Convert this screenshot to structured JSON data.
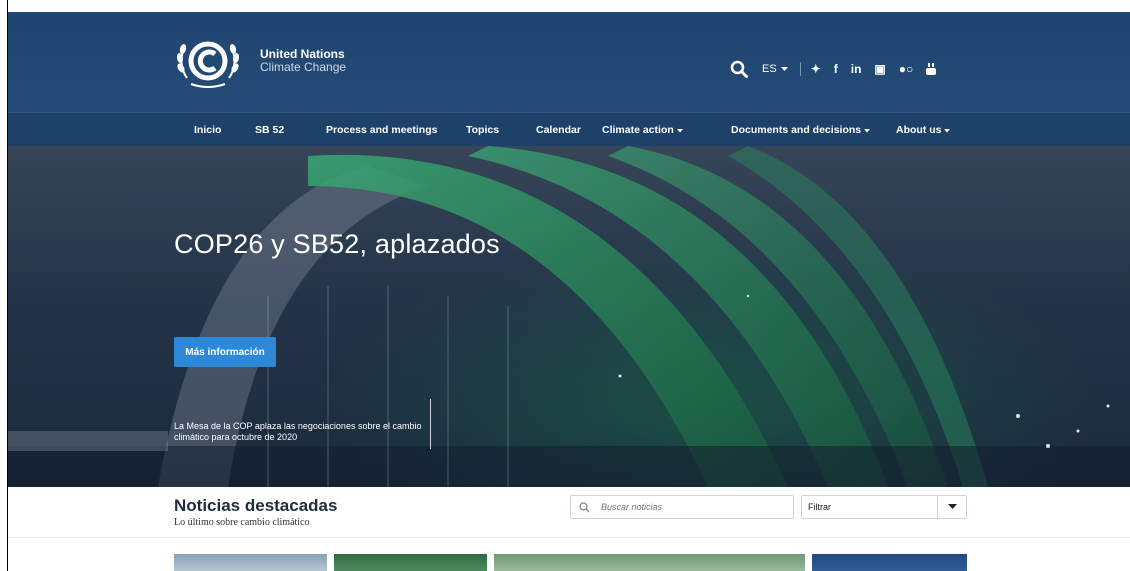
{
  "brand": {
    "line1": "United Nations",
    "line2": "Climate Change"
  },
  "header": {
    "language": "ES",
    "social_icons": [
      "twitter-icon",
      "facebook-icon",
      "linkedin-icon",
      "instagram-icon",
      "flickr-icon",
      "youtube-icon"
    ],
    "social_glyphs": {
      "twitter": "✦",
      "facebook": "f",
      "linkedin": "in",
      "instagram": "▣",
      "flickr": "●○"
    }
  },
  "nav": {
    "items": [
      {
        "label": "Inicio"
      },
      {
        "label": "SB 52"
      },
      {
        "label": "Process and meetings"
      },
      {
        "label": "Topics"
      },
      {
        "label": "Calendar"
      },
      {
        "label": "Climate action"
      },
      {
        "label": "Documents and decisions"
      },
      {
        "label": "About us"
      }
    ]
  },
  "hero": {
    "title": "COP26 y SB52, aplazados",
    "button": "Más información",
    "caption": "La Mesa de la COP aplaza las negociaciones sobre el cambio climático para octubre de 2020"
  },
  "news": {
    "title": "Noticias destacadas",
    "subtitle": "Lo último sobre cambio climático",
    "search_placeholder": "Buscar noticias",
    "filter_label": "Filtrar"
  },
  "colors": {
    "header": "#1f4670",
    "nav": "#1d4169",
    "button": "#2d88d8",
    "accent_green": "#2e9a63"
  }
}
